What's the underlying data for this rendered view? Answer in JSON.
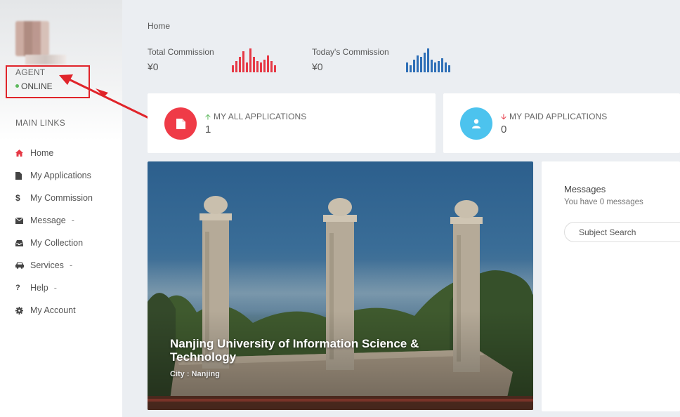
{
  "user": {
    "role": "AGENT",
    "status": "ONLINE"
  },
  "sidebar": {
    "section_title": "MAIN LINKS",
    "items": [
      {
        "label": "Home",
        "icon": "home-icon",
        "suffix": ""
      },
      {
        "label": "My Applications",
        "icon": "file-icon",
        "suffix": ""
      },
      {
        "label": "My Commission",
        "icon": "dollar-icon",
        "suffix": ""
      },
      {
        "label": "Message",
        "icon": "envelope-icon",
        "suffix": "-"
      },
      {
        "label": "My Collection",
        "icon": "inbox-icon",
        "suffix": ""
      },
      {
        "label": "Services",
        "icon": "car-icon",
        "suffix": "-"
      },
      {
        "label": "Help",
        "icon": "question-icon",
        "suffix": "-"
      },
      {
        "label": "My Account",
        "icon": "gear-icon",
        "suffix": ""
      }
    ]
  },
  "breadcrumb": "Home",
  "stats": {
    "total": {
      "label": "Total Commission",
      "value": "¥0",
      "bars": [
        10,
        16,
        22,
        30,
        14,
        34,
        22,
        16,
        14,
        18,
        24,
        16,
        10
      ],
      "color": "#e63946"
    },
    "today": {
      "label": "Today's Commission",
      "value": "¥0",
      "bars": [
        14,
        10,
        18,
        24,
        22,
        28,
        34,
        18,
        14,
        16,
        20,
        14,
        10
      ],
      "color": "#2e6fb7"
    }
  },
  "cards": {
    "all_applications": {
      "title": "MY ALL APPLICATIONS",
      "value": "1",
      "color": "#ef3b47",
      "trend_color": "#5cb85c"
    },
    "paid_applications": {
      "title": "MY PAID APPLICATIONS",
      "value": "0",
      "color": "#4cc3ee",
      "trend_color": "#e63946"
    }
  },
  "featured": {
    "title": "Nanjing University of Information Science & Technology",
    "city": "City : Nanjing"
  },
  "messages": {
    "title": "Messages",
    "subtitle": "You have 0 messages",
    "search_placeholder": "Subject Search"
  }
}
